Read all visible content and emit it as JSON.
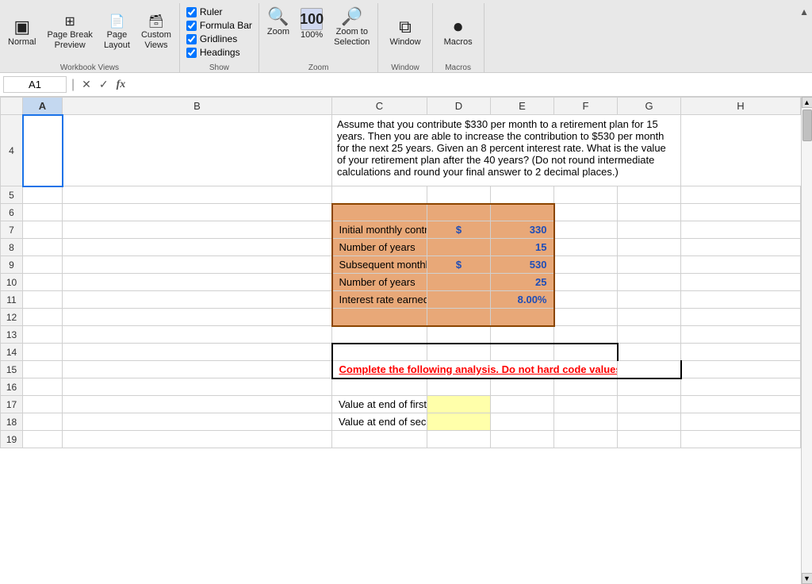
{
  "ribbon": {
    "workbook_views": {
      "label": "Workbook Views",
      "normal_label": "Normal",
      "page_break_label": "Page Break\nPreview",
      "page_layout_label": "Page\nLayout",
      "custom_views_label": "Custom\nViews"
    },
    "show": {
      "label": "Show",
      "ruler_label": "Ruler",
      "gridlines_label": "Gridlines",
      "formula_bar_label": "Formula Bar",
      "headings_label": "Headings",
      "ruler_checked": true,
      "gridlines_checked": true,
      "formula_bar_checked": true,
      "headings_checked": true
    },
    "zoom": {
      "label": "Zoom",
      "zoom_label": "Zoom",
      "zoom_100_label": "100%",
      "zoom_to_selection_label": "Zoom to\nSelection"
    },
    "window": {
      "label": "Window",
      "window_label": "Window"
    },
    "macros": {
      "label": "Macros",
      "macros_label": "Macros"
    }
  },
  "formula_bar": {
    "cell_ref": "A1",
    "formula": ""
  },
  "spreadsheet": {
    "col_headers": [
      "",
      "A",
      "B",
      "C",
      "D",
      "E",
      "F",
      "G",
      "H"
    ],
    "rows": [
      {
        "num": "4",
        "data": {
          "c": "Assume that you contribute $330 per month to a retirement plan for 15 years. Then you are able to increase the contribution to $530 per month for the next 25 years. Given an 8 percent interest rate. What is the value of your retirement plan after the 40 years? (Do not round intermediate calculations and round your final answer to 2 decimal places.)",
          "style_c": "multiline"
        }
      },
      {
        "num": "5",
        "data": {}
      },
      {
        "num": "6",
        "data": {
          "c": "",
          "style_c": "orange"
        }
      },
      {
        "num": "7",
        "data": {
          "c": "Initial monthly contribution",
          "d_dollar": "$",
          "d_val": "330",
          "style": "orange"
        }
      },
      {
        "num": "8",
        "data": {
          "c": "Number of years",
          "d_val": "15",
          "style": "orange"
        }
      },
      {
        "num": "9",
        "data": {
          "c": "Subsequent monthly contribution",
          "d_dollar": "$",
          "d_val": "530",
          "style": "orange"
        }
      },
      {
        "num": "10",
        "data": {
          "c": "Number of years",
          "d_val": "25",
          "style": "orange"
        }
      },
      {
        "num": "11",
        "data": {
          "c": "Interest rate earned",
          "d_val": "8.00%",
          "style": "orange"
        }
      },
      {
        "num": "12",
        "data": {
          "c": "",
          "style": "orange"
        }
      },
      {
        "num": "13",
        "data": {}
      },
      {
        "num": "14",
        "data": {}
      },
      {
        "num": "15",
        "data": {
          "c": "Complete the following analysis. Do not hard code values in your calculations.",
          "style_c": "red-bold-underline",
          "style": "black-box"
        }
      },
      {
        "num": "16",
        "data": {}
      },
      {
        "num": "17",
        "data": {
          "c": "Value at end of first set of contributions",
          "d_style": "yellow"
        }
      },
      {
        "num": "18",
        "data": {
          "c": "Value at end of second set of contributions",
          "d_style": "yellow"
        }
      },
      {
        "num": "19",
        "data": {}
      }
    ]
  }
}
